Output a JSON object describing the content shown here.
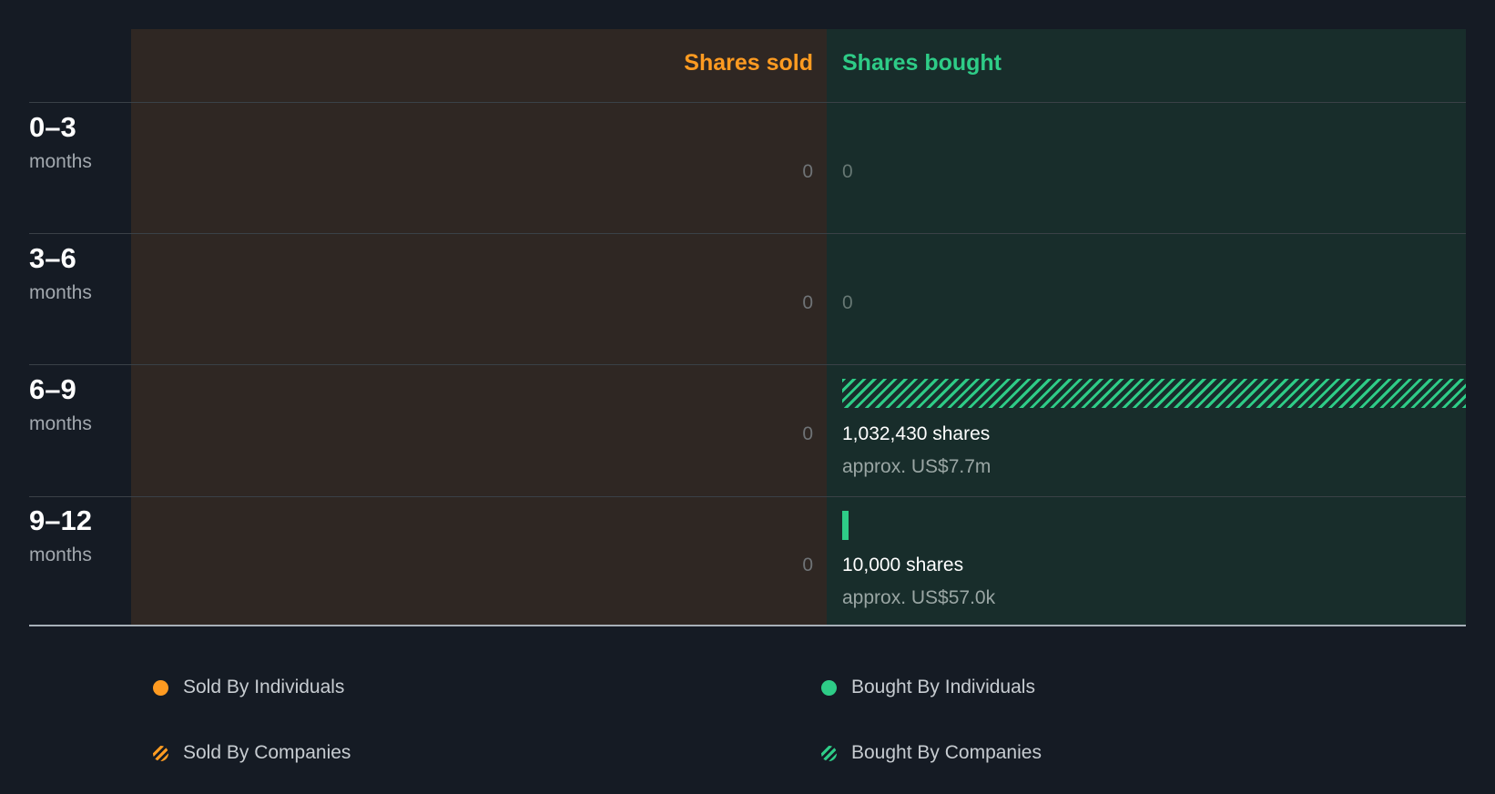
{
  "colors": {
    "sold": "#ff9b21",
    "bought": "#2ecc87",
    "background": "#151b24",
    "sold_panel": "#2f2723",
    "bought_panel": "#182d2b"
  },
  "headers": {
    "sold": "Shares sold",
    "bought": "Shares bought"
  },
  "rows": [
    {
      "range": "0–3",
      "unit": "months",
      "sold": "0",
      "bought": "0"
    },
    {
      "range": "3–6",
      "unit": "months",
      "sold": "0",
      "bought": "0"
    },
    {
      "range": "6–9",
      "unit": "months",
      "sold": "0",
      "bought_shares": "1,032,430 shares",
      "bought_approx": "approx. US$7.7m"
    },
    {
      "range": "9–12",
      "unit": "months",
      "sold": "0",
      "bought_shares": "10,000 shares",
      "bought_approx": "approx. US$57.0k"
    }
  ],
  "legend": [
    {
      "label": "Sold By Individuals",
      "icon": "sold-individuals-icon"
    },
    {
      "label": "Bought By Individuals",
      "icon": "bought-individuals-icon"
    },
    {
      "label": "Sold By Companies",
      "icon": "sold-companies-icon"
    },
    {
      "label": "Bought By Companies",
      "icon": "bought-companies-icon"
    }
  ],
  "chart_data": {
    "type": "bar",
    "categories": [
      "0–3 months",
      "3–6 months",
      "6–9 months",
      "9–12 months"
    ],
    "series": [
      {
        "name": "Sold By Individuals",
        "values": [
          0,
          0,
          0,
          0
        ]
      },
      {
        "name": "Sold By Companies",
        "values": [
          0,
          0,
          0,
          0
        ]
      },
      {
        "name": "Bought By Individuals",
        "values": [
          0,
          0,
          0,
          10000
        ]
      },
      {
        "name": "Bought By Companies",
        "values": [
          0,
          0,
          1032430,
          0
        ]
      }
    ],
    "bought_value_usd": [
      "",
      "",
      "approx. US$7.7m",
      "approx. US$57.0k"
    ],
    "max": 1032430,
    "legend_position": "bottom"
  }
}
